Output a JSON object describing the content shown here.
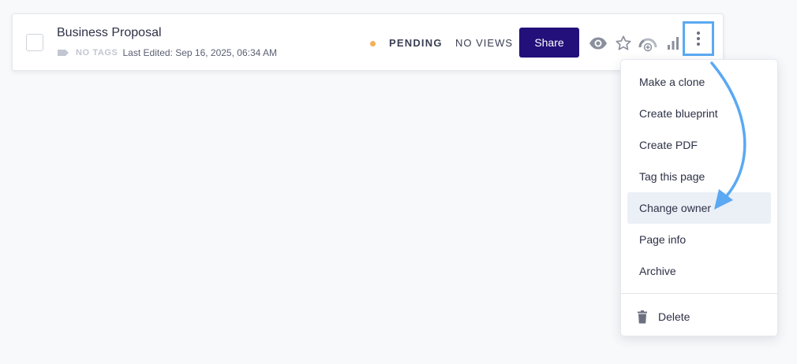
{
  "document": {
    "title": "Business Proposal",
    "tags_label": "NO TAGS",
    "last_edited": "Last Edited: Sep 16, 2025, 06:34 AM",
    "status": "PENDING",
    "views": "NO VIEWS",
    "share_label": "Share"
  },
  "icons": {
    "tag": "tag-icon",
    "eye": "eye-icon",
    "star": "star-icon",
    "gauge": "gauge-icon",
    "bars": "signal-bars-icon",
    "more": "more-vertical-icon",
    "trash": "trash-icon"
  },
  "menu": {
    "items": [
      {
        "label": "Make a clone"
      },
      {
        "label": "Create blueprint"
      },
      {
        "label": "Create PDF"
      },
      {
        "label": "Tag this page"
      },
      {
        "label": "Change owner"
      },
      {
        "label": "Page info"
      },
      {
        "label": "Archive"
      }
    ],
    "highlighted_index": 4,
    "delete_label": "Delete"
  },
  "colors": {
    "background": "#f8f9fb",
    "share_button": "#23107a",
    "status_dot": "#f5b05a",
    "highlight_border": "#5aa9f2",
    "menu_hover": "#ebeff6",
    "icon_gray": "#8a8f9c"
  }
}
